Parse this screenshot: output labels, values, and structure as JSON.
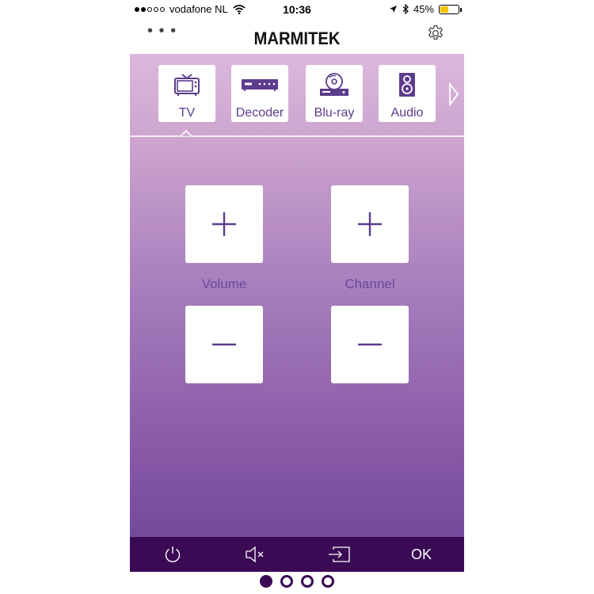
{
  "status_bar": {
    "carrier": "vodafone NL",
    "time": "10:36",
    "battery": "45%",
    "battery_level": 0.45,
    "signal_bars_filled": 2,
    "signal_bars_total": 5
  },
  "header": {
    "logo": "MARMITEK",
    "menu_icon": "more-dots-icon",
    "settings_icon": "gear-icon"
  },
  "devices": [
    {
      "label": "TV",
      "icon": "tv-icon",
      "selected": true
    },
    {
      "label": "Decoder",
      "icon": "decoder-icon",
      "selected": false
    },
    {
      "label": "Blu-ray",
      "icon": "bluray-icon",
      "selected": false
    },
    {
      "label": "Audio",
      "icon": "speaker-icon",
      "selected": false
    }
  ],
  "controls": {
    "volume_label": "Volume",
    "channel_label": "Channel"
  },
  "bottom_bar": {
    "power_icon": "power-icon",
    "mute_icon": "mute-icon",
    "input_icon": "input-source-icon",
    "ok_label": "OK"
  },
  "pager": {
    "pages": 4,
    "active": 1
  },
  "colors": {
    "accent": "#5c3c8c",
    "bar": "#3a0a55",
    "battery": "#f2c200"
  }
}
